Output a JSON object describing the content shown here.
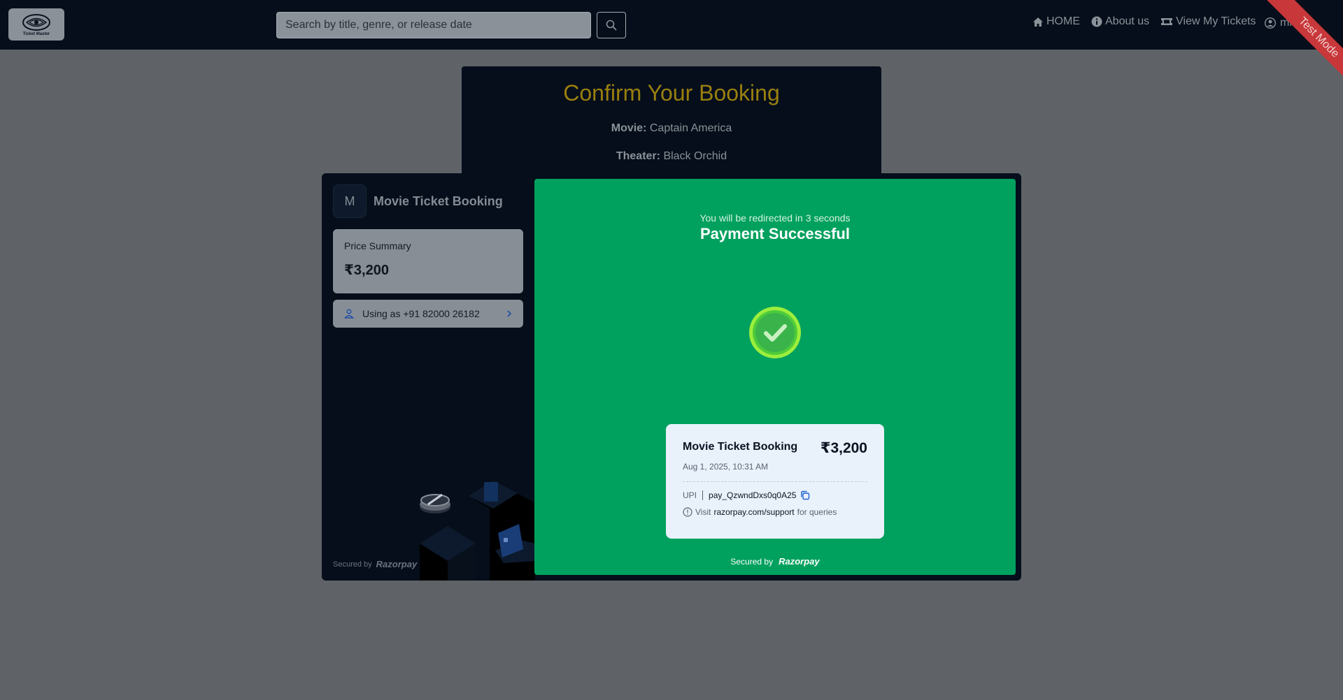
{
  "navbar": {
    "logo_text": "Ticket Master",
    "search_placeholder": "Search by title, genre, or release date",
    "links": [
      {
        "label": "HOME",
        "icon": "home-icon"
      },
      {
        "label": "About us",
        "icon": "info-icon"
      },
      {
        "label": "View My Tickets",
        "icon": "ticket-icon"
      }
    ],
    "user_label": "min",
    "ribbon": "Test Mode"
  },
  "booking": {
    "title": "Confirm Your Booking",
    "movie_label": "Movie:",
    "movie_value": "Captain America",
    "theater_label": "Theater:",
    "theater_value": "Black Orchid"
  },
  "razorpay": {
    "merchant_initial": "M",
    "merchant_name": "Movie Ticket Booking",
    "price_summary_label": "Price Summary",
    "price": "₹3,200",
    "using_as": "Using as +91 82000 26182",
    "secured_by": "Secured by",
    "brand": "Razorpay",
    "redirect_text": "You will be redirected in 3 seconds",
    "success_title": "Payment Successful",
    "receipt": {
      "merchant": "Movie Ticket Booking",
      "amount": "₹3,200",
      "date": "Aug 1, 2025, 10:31 AM",
      "method": "UPI",
      "payment_id": "pay_QzwndDxs0q0A25",
      "visit_prefix": "Visit",
      "visit_link": "razorpay.com/support",
      "visit_suffix": "for queries"
    }
  },
  "colors": {
    "navbar_bg": "#050e1a",
    "overlay_bg": "#5f6368",
    "success_green": "#00a15e",
    "title_gold": "#9a7f0f",
    "ribbon_red": "#c8373a"
  }
}
